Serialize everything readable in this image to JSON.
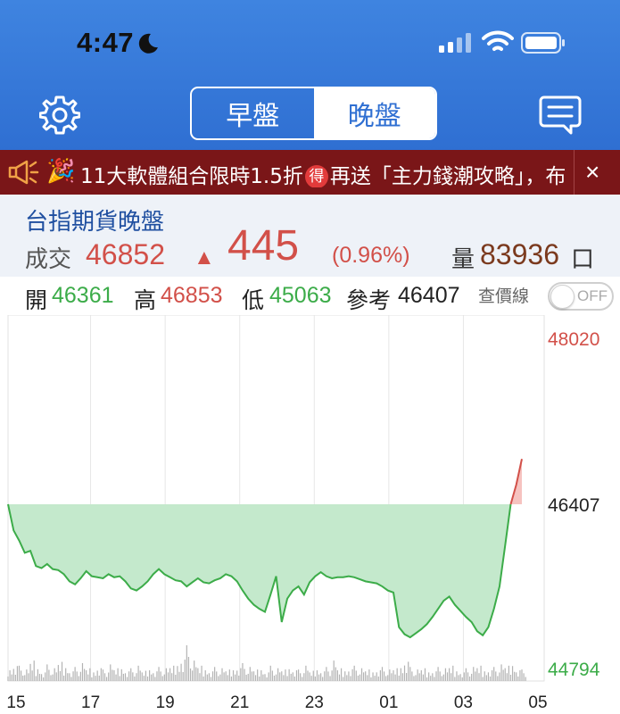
{
  "status_bar": {
    "time": "4:47"
  },
  "header": {
    "tabs": [
      {
        "label": "早盤",
        "active": false
      },
      {
        "label": "晚盤",
        "active": true
      }
    ],
    "colors": {
      "gradient_top": "#3f84e0",
      "gradient_bottom": "#2f6fd2"
    }
  },
  "banner": {
    "party_glyph": "🎉",
    "text_before": "11大軟體組合限時1.5折",
    "badge": "得",
    "text_after": "再送「主力錢潮攻略」，布",
    "close": "×",
    "color": "#7a1618"
  },
  "quote": {
    "title": "台指期貨晚盤",
    "trade_label": "成交",
    "price": "46852",
    "arrow": "▲",
    "change": "445",
    "change_pct": "(0.96%)",
    "volume_label": "量",
    "volume": "83936",
    "volume_unit": "口"
  },
  "ohlc": {
    "open_label": "開",
    "open": "46361",
    "high_label": "高",
    "high": "46853",
    "low_label": "低",
    "low": "45063",
    "ref_label": "參考",
    "ref": "46407",
    "toggle_label": "查價線",
    "toggle_state": "OFF"
  },
  "chart_data": {
    "type": "area",
    "y_labels": {
      "top": "48020",
      "ref": "46407",
      "bottom": "44794"
    },
    "ylim": [
      44794,
      48020
    ],
    "reference": 46407,
    "x_tick_labels": [
      "15",
      "17",
      "19",
      "21",
      "23",
      "01",
      "03",
      "05"
    ],
    "grid": true,
    "colors": {
      "up": "#d25049",
      "down": "#3cac49",
      "fill_down": "#c4e9cc",
      "fill_up": "#f6c3c0",
      "volume": "#b3b3b3"
    },
    "price_series": [
      46407,
      46150,
      46050,
      45930,
      45950,
      45800,
      45780,
      45820,
      45770,
      45760,
      45720,
      45650,
      45620,
      45680,
      45750,
      45700,
      45690,
      45680,
      45720,
      45690,
      45700,
      45650,
      45580,
      45560,
      45600,
      45650,
      45720,
      45770,
      45720,
      45690,
      45660,
      45650,
      45600,
      45640,
      45680,
      45640,
      45630,
      45660,
      45680,
      45720,
      45700,
      45650,
      45560,
      45480,
      45420,
      45380,
      45350,
      45520,
      45700,
      45250,
      45480,
      45560,
      45600,
      45520,
      45640,
      45700,
      45740,
      45700,
      45680,
      45690,
      45690,
      45700,
      45690,
      45670,
      45650,
      45640,
      45630,
      45600,
      45560,
      45540,
      45200,
      45130,
      45100,
      45140,
      45180,
      45230,
      45300,
      45380,
      45460,
      45500,
      45420,
      45360,
      45300,
      45250,
      45160,
      45120,
      45200,
      45380,
      45600,
      46000,
      46407,
      46600,
      46852
    ],
    "volume_series": [
      10,
      14,
      12,
      9,
      16,
      11,
      8,
      13,
      10,
      15,
      12,
      9,
      11,
      14,
      10,
      8,
      12,
      9,
      13,
      10,
      11,
      9,
      10,
      12,
      8,
      10,
      9,
      11,
      10,
      12,
      14,
      20,
      28,
      16,
      12,
      10,
      9,
      11,
      10,
      9,
      10,
      12,
      14,
      11,
      9,
      10,
      8,
      12,
      10,
      9,
      11,
      10,
      9,
      12,
      8,
      10,
      9,
      11,
      16,
      10,
      9,
      11,
      12,
      10,
      9,
      8,
      10,
      11,
      9,
      10,
      12,
      18,
      11,
      9,
      10,
      8,
      9,
      11,
      10,
      12,
      9,
      8,
      10,
      11,
      12,
      9,
      10,
      11,
      13,
      12,
      14,
      10,
      9
    ]
  }
}
